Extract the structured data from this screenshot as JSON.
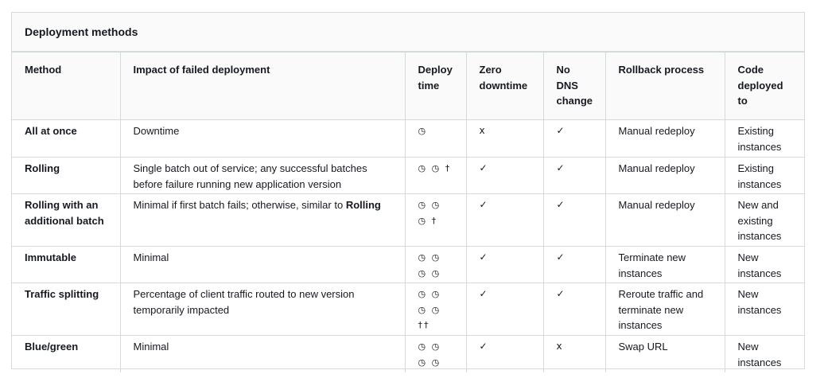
{
  "title": "Deployment methods",
  "headers": {
    "method": "Method",
    "impact": "Impact of failed deployment",
    "deploy_time": "Deploy time",
    "zero_downtime": "Zero downtime",
    "no_dns": "No DNS change",
    "rollback": "Rollback process",
    "code_deployed": "Code deployed to"
  },
  "rows": [
    {
      "method": "All at once",
      "impact": "Downtime",
      "impact_bold": "",
      "deploy_time": "◷",
      "zero_downtime": "x",
      "no_dns": "✓",
      "rollback": "Manual redeploy",
      "code_deployed": "Existing instances"
    },
    {
      "method": "Rolling",
      "impact": "Single batch out of service; any successful batches before failure running new application version",
      "impact_bold": "",
      "deploy_time": "◷ ◷ †",
      "zero_downtime": "✓",
      "no_dns": "✓",
      "rollback": "Manual redeploy",
      "code_deployed": "Existing instances"
    },
    {
      "method": "Rolling with an additional batch",
      "impact": "Minimal if first batch fails; otherwise, similar to",
      "impact_bold": "Rolling",
      "deploy_time": "◷ ◷ ◷ †",
      "zero_downtime": "✓",
      "no_dns": "✓",
      "rollback": "Manual redeploy",
      "code_deployed": "New and existing instances"
    },
    {
      "method": "Immutable",
      "impact": "Minimal",
      "impact_bold": "",
      "deploy_time": "◷ ◷ ◷ ◷",
      "zero_downtime": "✓",
      "no_dns": "✓",
      "rollback": "Terminate new instances",
      "code_deployed": "New instances"
    },
    {
      "method": "Traffic splitting",
      "impact": "Percentage of client traffic routed to new version temporarily impacted",
      "impact_bold": "",
      "deploy_time": "◷ ◷ ◷ ◷ ††",
      "zero_downtime": "✓",
      "no_dns": "✓",
      "rollback": "Reroute traffic and terminate new instances",
      "code_deployed": "New instances"
    },
    {
      "method": "Blue/green",
      "impact": "Minimal",
      "impact_bold": "",
      "deploy_time": "◷ ◷ ◷ ◷",
      "zero_downtime": "✓",
      "no_dns": "x",
      "rollback": "Swap URL",
      "code_deployed": "New instances"
    }
  ]
}
